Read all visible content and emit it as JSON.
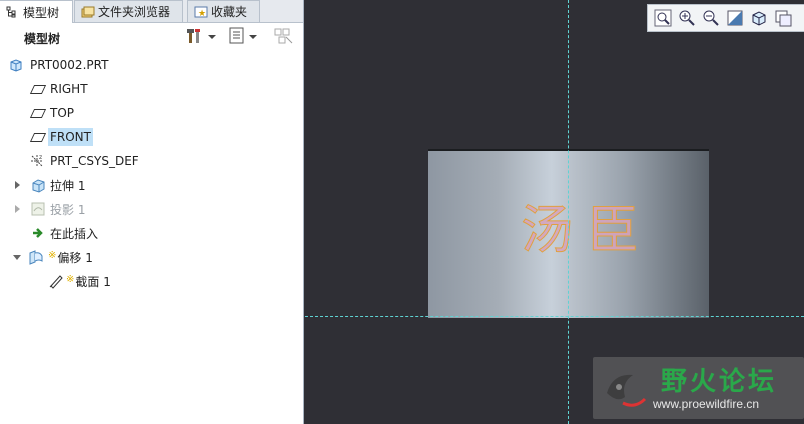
{
  "tabs": [
    {
      "label": "模型树",
      "icon": "model-tree-icon"
    },
    {
      "label": "文件夹浏览器",
      "icon": "folder-browser-icon"
    },
    {
      "label": "收藏夹",
      "icon": "favorites-icon"
    }
  ],
  "panel": {
    "title": "模型树",
    "tools": [
      "settings-tools-icon",
      "show-list-icon",
      "filter-icon"
    ]
  },
  "tree": [
    {
      "label": "PRT0002.PRT",
      "icon": "part-icon"
    },
    {
      "label": "RIGHT",
      "icon": "datum-plane-icon"
    },
    {
      "label": "TOP",
      "icon": "datum-plane-icon"
    },
    {
      "label": "FRONT",
      "icon": "datum-plane-icon",
      "selected": true
    },
    {
      "label": "PRT_CSYS_DEF",
      "icon": "csys-icon"
    },
    {
      "label": "拉伸 1",
      "icon": "extrude-icon",
      "expander": "collapsed"
    },
    {
      "label": "投影 1",
      "icon": "project-icon",
      "expander": "collapsed",
      "disabled": true
    },
    {
      "label": "在此插入",
      "icon": "insert-here-arrow-icon"
    },
    {
      "label": "偏移 1",
      "icon": "offset-icon",
      "expander": "expanded",
      "new": true
    },
    {
      "label": "截面 1",
      "icon": "sketch-icon",
      "new": true
    }
  ],
  "view_toolbar": [
    "refit-icon",
    "zoom-in-icon",
    "zoom-out-icon",
    "repaint-icon",
    "saved-views-icon",
    "layers-icon"
  ],
  "model": {
    "emboss_text": "汤臣"
  },
  "watermark": {
    "name": "野火论坛",
    "url": "www.proewildfire.cn"
  },
  "colors": {
    "viewport_bg": "#2f2f35",
    "selection": "#bfe0f7",
    "axis": "#5fd3d3"
  }
}
